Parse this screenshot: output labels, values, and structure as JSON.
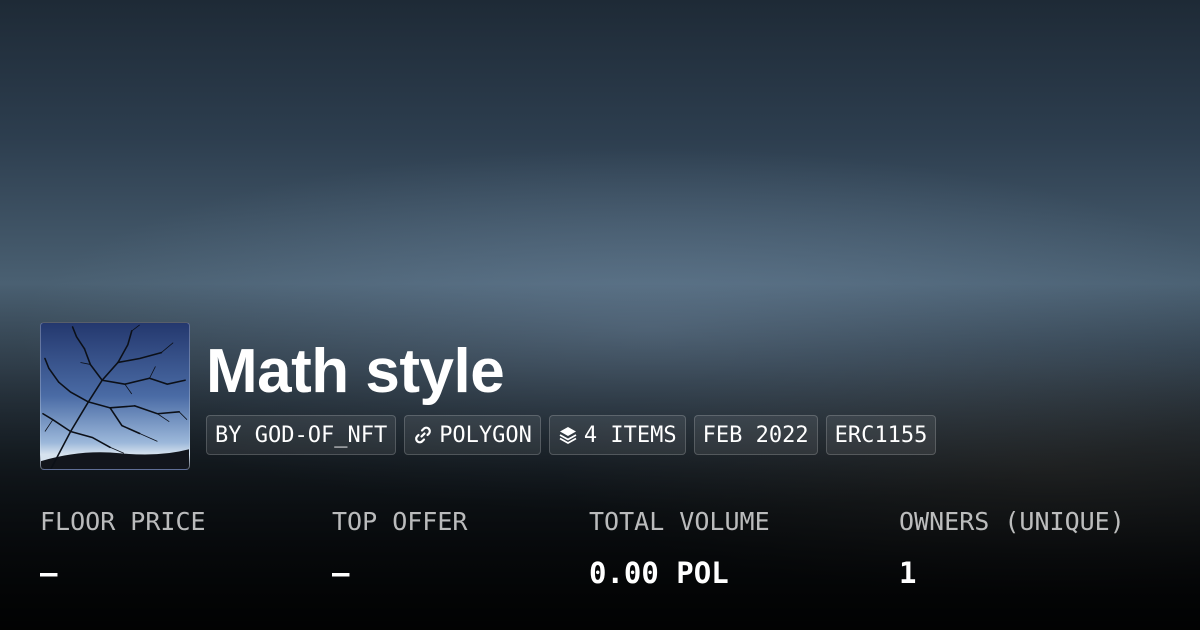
{
  "collection": {
    "name": "Math style",
    "chips": [
      {
        "icon": "",
        "label": "BY GOD-OF_NFT"
      },
      {
        "icon": "link-icon",
        "label": "POLYGON"
      },
      {
        "icon": "layers-icon",
        "label": "4 ITEMS"
      },
      {
        "icon": "",
        "label": "FEB 2022"
      },
      {
        "icon": "",
        "label": "ERC1155"
      }
    ]
  },
  "stats": [
    {
      "label": "FLOOR PRICE",
      "value": "–"
    },
    {
      "label": "TOP OFFER",
      "value": "–"
    },
    {
      "label": "TOTAL VOLUME",
      "value": "0.00 POL"
    },
    {
      "label": "OWNERS (UNIQUE)",
      "value": "1"
    }
  ],
  "colors": {
    "text": "#ffffff",
    "label": "#b8bfc6",
    "chip_bg": "#2a3440"
  }
}
